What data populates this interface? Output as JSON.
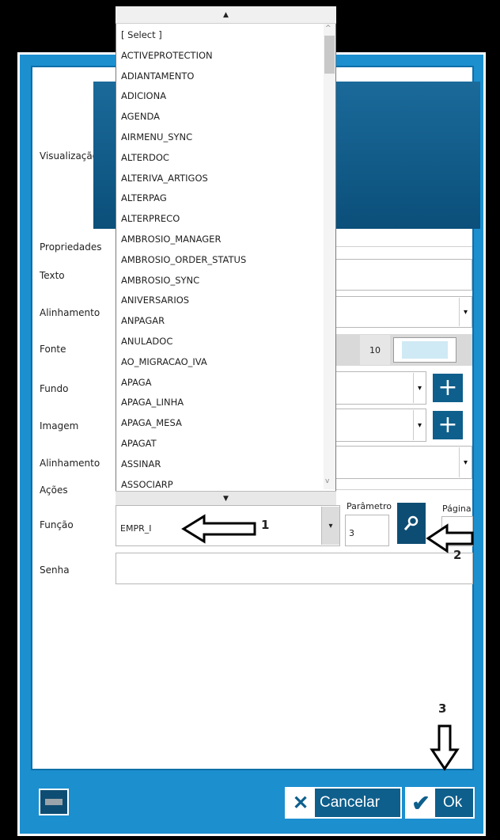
{
  "form": {
    "preview_label": "Visualização",
    "properties_label": "Propriedades",
    "text_label": "Texto",
    "align_label": "Alinhamento",
    "font_label": "Fonte",
    "font_size": "10",
    "background_label": "Fundo",
    "image_label": "Imagem",
    "align2_label": "Alinhamento",
    "actions_label": "Ações",
    "function_label": "Função",
    "function_value": "EMPR_I",
    "parameter_label": "Parâmetro",
    "parameter_value": "3",
    "page_label": "Página",
    "password_label": "Senha"
  },
  "dropdown": {
    "items": [
      "[ Select ]",
      "ACTIVEPROTECTION",
      "ADIANTAMENTO",
      "ADICIONA",
      "AGENDA",
      "AIRMENU_SYNC",
      "ALTERDOC",
      "ALTERIVA_ARTIGOS",
      "ALTERPAG",
      "ALTERPRECO",
      "AMBROSIO_MANAGER",
      "AMBROSIO_ORDER_STATUS",
      "AMBROSIO_SYNC",
      "ANIVERSARIOS",
      "ANPAGAR",
      "ANULADOC",
      "AO_MIGRACAO_IVA",
      "APAGA",
      "APAGA_LINHA",
      "APAGA_MESA",
      "APAGAT",
      "ASSINAR",
      "ASSOCIARP"
    ]
  },
  "buttons": {
    "cancel_label": "Cancelar",
    "ok_label": "Ok"
  },
  "annotations": {
    "a1": "1",
    "a2": "2",
    "a3": "3"
  },
  "colors": {
    "frame": "#1c8fcf",
    "button": "#0e5f8c",
    "preview": "#0b4f7a"
  }
}
